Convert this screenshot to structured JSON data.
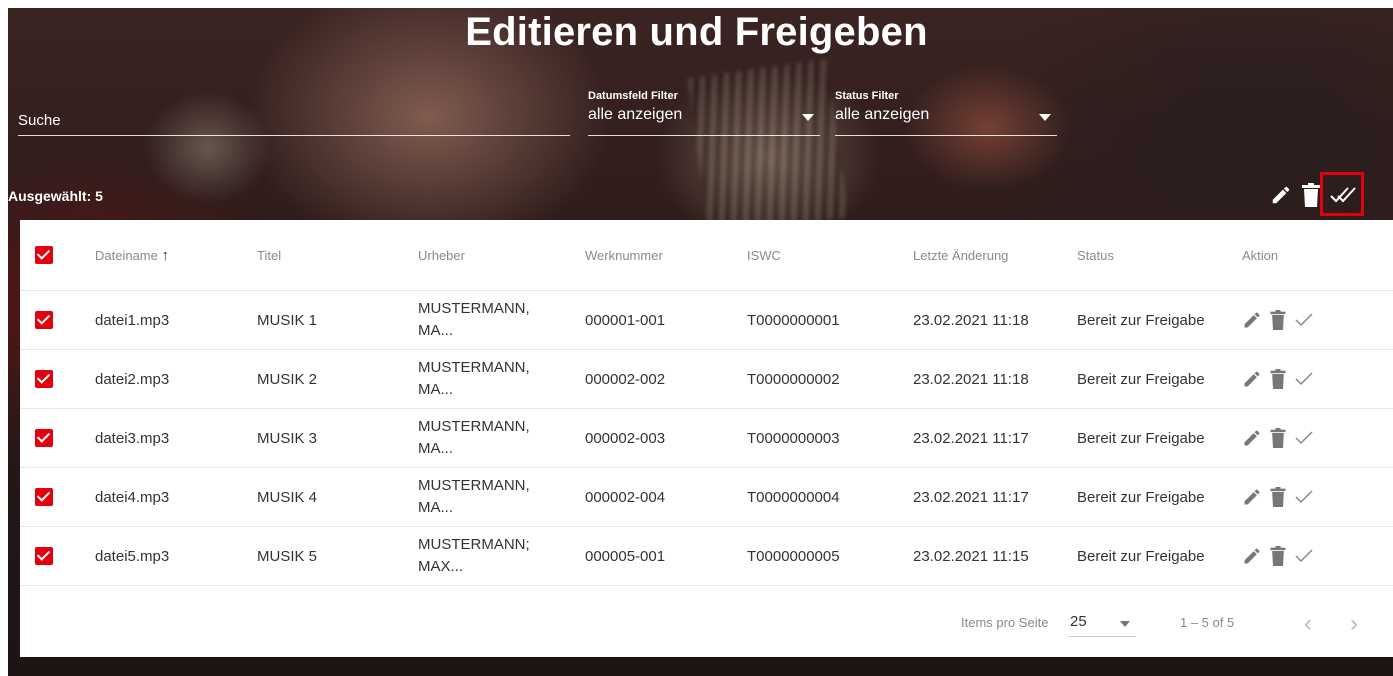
{
  "header": {
    "title": "Editieren und Freigeben",
    "search_placeholder": "Suche",
    "date_filter": {
      "label": "Datumsfeld Filter",
      "value": "alle anzeigen"
    },
    "status_filter": {
      "label": "Status Filter",
      "value": "alle anzeigen"
    },
    "selected_label": "Ausgewählt: 5"
  },
  "colors": {
    "accent": "#e3000f"
  },
  "icons": {
    "edit": "pencil-icon",
    "delete": "trash-icon",
    "approve": "check-icon",
    "approve_all": "double-check-icon",
    "sort": "arrow-up-icon"
  },
  "table": {
    "columns": [
      "Dateiname",
      "Titel",
      "Urheber",
      "Werknummer",
      "ISWC",
      "Letzte Änderung",
      "Status",
      "Aktion"
    ],
    "sort_indicator": "↑",
    "rows": [
      {
        "file": "datei1.mp3",
        "title": "MUSIK 1",
        "author1": "MUSTERMANN,",
        "author2": "MA...",
        "work": "000001-001",
        "iswc": "T0000000001",
        "changed": "23.02.2021 11:18",
        "status": "Bereit zur Freigabe"
      },
      {
        "file": "datei2.mp3",
        "title": "MUSIK 2",
        "author1": "MUSTERMANN,",
        "author2": "MA...",
        "work": "000002-002",
        "iswc": "T0000000002",
        "changed": "23.02.2021 11:18",
        "status": "Bereit zur Freigabe"
      },
      {
        "file": "datei3.mp3",
        "title": "MUSIK 3",
        "author1": "MUSTERMANN,",
        "author2": "MA...",
        "work": "000002-003",
        "iswc": "T0000000003",
        "changed": "23.02.2021 11:17",
        "status": "Bereit zur Freigabe"
      },
      {
        "file": "datei4.mp3",
        "title": "MUSIK 4",
        "author1": "MUSTERMANN,",
        "author2": "MA...",
        "work": "000002-004",
        "iswc": "T0000000004",
        "changed": "23.02.2021 11:17",
        "status": "Bereit zur Freigabe"
      },
      {
        "file": "datei5.mp3",
        "title": "MUSIK 5",
        "author1": "MUSTERMANN;",
        "author2": "MAX...",
        "work": "000005-001",
        "iswc": "T0000000005",
        "changed": "23.02.2021 11:15",
        "status": "Bereit zur Freigabe"
      }
    ]
  },
  "paginator": {
    "items_label": "Items pro Seite",
    "page_size": "25",
    "range": "1 – 5 of 5"
  }
}
